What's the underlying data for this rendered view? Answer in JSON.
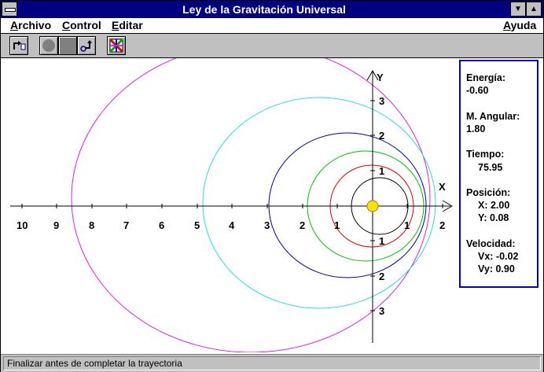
{
  "window": {
    "title": "Ley de la Gravitación Universal"
  },
  "menu": {
    "archivo": {
      "first": "A",
      "rest": "rchivo"
    },
    "control": {
      "first": "C",
      "rest": "ontrol"
    },
    "editar": {
      "first": "E",
      "rest": "ditar"
    },
    "ayuda": {
      "first": "A",
      "rest": "yuda"
    }
  },
  "toolbar": {
    "icons": [
      "new-orbit-icon",
      "start-icon",
      "stop-icon",
      "step-icon",
      "colors-icon"
    ]
  },
  "plot": {
    "x_axis_label": "X",
    "y_axis_label": "Y",
    "x_ticks": [
      "10",
      "9",
      "8",
      "7",
      "6",
      "5",
      "4",
      "3",
      "2",
      "1",
      "1",
      "2"
    ],
    "y_ticks": [
      "3",
      "2",
      "1",
      "1",
      "2",
      "3"
    ],
    "colors": {
      "magenta": "#e020e0",
      "cyan": "#20e0e0",
      "blue": "#0000a0",
      "green": "#00c000",
      "red": "#e00000",
      "black": "#000000",
      "sun": "#ffe000"
    }
  },
  "info": {
    "energia_label": "Energía:",
    "energia_value": "-0.60",
    "angular_label": "M. Angular:",
    "angular_value": "1.80",
    "tiempo_label": "Tiempo:",
    "tiempo_value": "75.95",
    "posicion_label": "Posición:",
    "x_line": "X: 2.00",
    "y_line": "Y: 0.08",
    "velocidad_label": "Velocidad:",
    "vx_line": "Vx: -0.02",
    "vy_line": "Vy: 0.90"
  },
  "status": {
    "text": "Finalizar antes de completar la trayectoria"
  }
}
